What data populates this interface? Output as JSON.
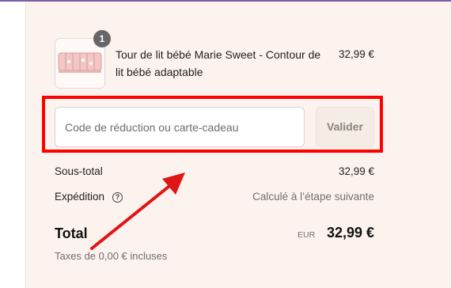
{
  "cart": {
    "item": {
      "name": "Tour de lit bébé Marie Sweet - Contour de lit bébé adaptable",
      "price": "32,99 €",
      "quantity": "1",
      "image": "baby-bed-bumper-thumbnail"
    }
  },
  "discount": {
    "placeholder": "Code de réduction ou carte-cadeau",
    "apply_label": "Valider"
  },
  "summary": {
    "subtotal_label": "Sous-total",
    "subtotal_value": "32,99 €",
    "shipping_label": "Expédition",
    "shipping_help_icon": "question-circle-icon",
    "shipping_value": "Calculé à l’étape suivante",
    "total_label": "Total",
    "currency": "EUR",
    "total_value": "32,99 €",
    "taxes_note": "Taxes de 0,00 € incluses"
  },
  "annotations": {
    "highlight_color": "#ff0000",
    "arrow_color": "#e01515"
  },
  "colors": {
    "page_background": "#fdf3ee",
    "top_accent": "#7b5ea7"
  }
}
